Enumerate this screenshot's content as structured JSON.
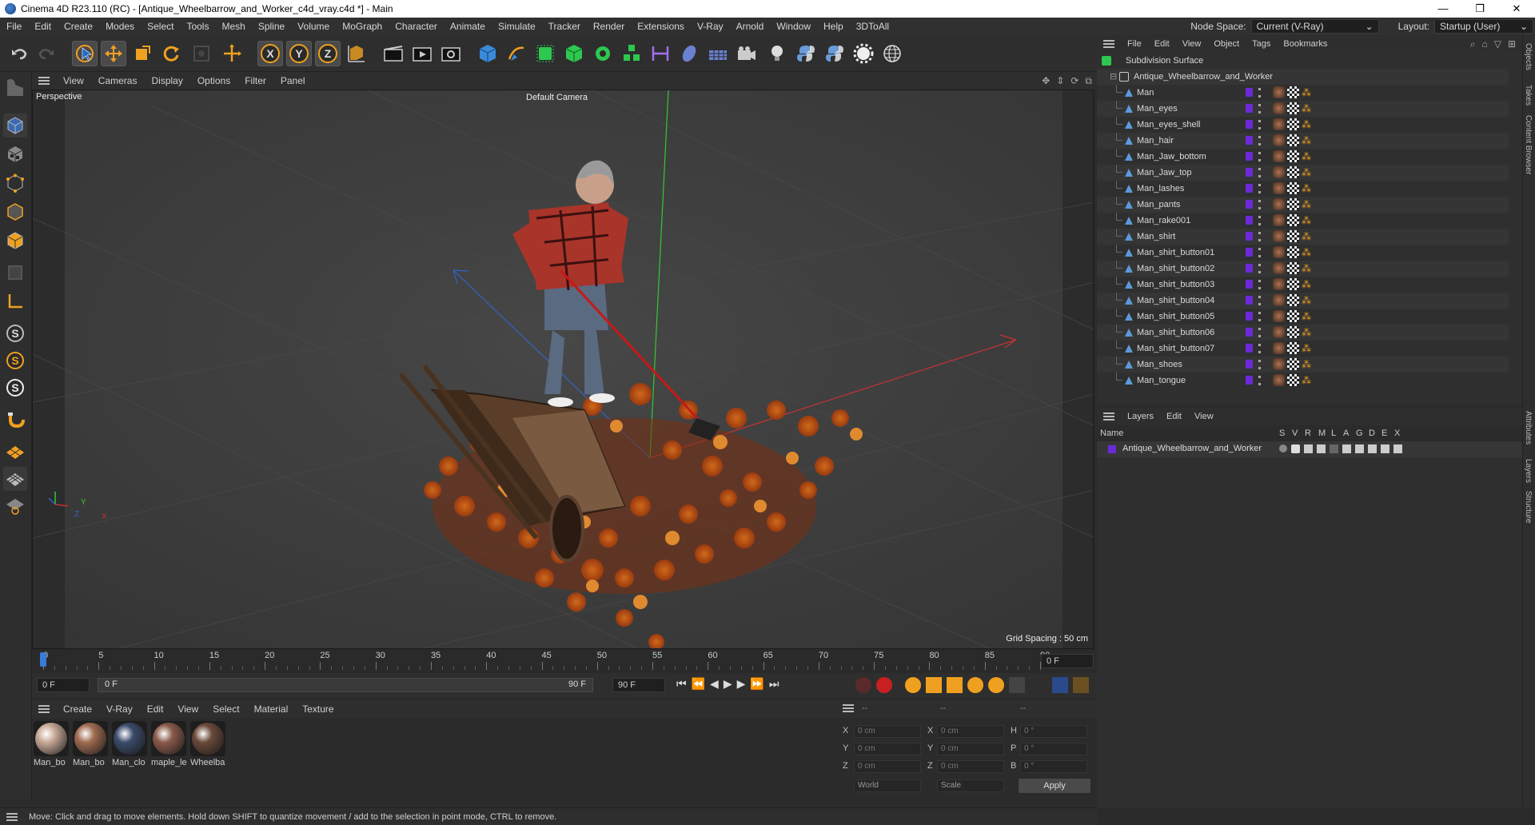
{
  "window": {
    "title": "Cinema 4D R23.110 (RC) - [Antique_Wheelbarrow_and_Worker_c4d_vray.c4d *] - Main",
    "buttons": [
      "—",
      "❐",
      "✕"
    ]
  },
  "menubar": {
    "items": [
      "File",
      "Edit",
      "Create",
      "Modes",
      "Select",
      "Tools",
      "Mesh",
      "Spline",
      "Volume",
      "MoGraph",
      "Character",
      "Animate",
      "Simulate",
      "Tracker",
      "Render",
      "Extensions",
      "V-Ray",
      "Arnold",
      "Window",
      "Help",
      "3DToAll"
    ],
    "node_space_label": "Node Space:",
    "node_space_value": "Current (V-Ray)",
    "layout_label": "Layout:",
    "layout_value": "Startup (User)"
  },
  "viewport": {
    "menu": [
      "View",
      "Cameras",
      "Display",
      "Options",
      "Filter",
      "Panel"
    ],
    "name": "Perspective",
    "camera": "Default Camera",
    "grid_spacing": "Grid Spacing : 50 cm",
    "axis_y": "Y",
    "axis_z": "Z",
    "axis_x": "X"
  },
  "timeline": {
    "ticks": [
      "0",
      "5",
      "10",
      "15",
      "20",
      "25",
      "30",
      "35",
      "40",
      "45",
      "50",
      "55",
      "60",
      "65",
      "70",
      "75",
      "80",
      "85",
      "90"
    ],
    "current_frame": "0 F"
  },
  "transport": {
    "start": "0 F",
    "range_start": "0 F",
    "range_end": "90 F",
    "end": "90 F"
  },
  "materials": {
    "menu": [
      "Create",
      "V-Ray",
      "Edit",
      "View",
      "Select",
      "Material",
      "Texture"
    ],
    "items": [
      {
        "label": "Man_bo",
        "color": "#c8a898"
      },
      {
        "label": "Man_bo",
        "color": "#a06a50"
      },
      {
        "label": "Man_clo",
        "color": "#3a4a6a"
      },
      {
        "label": "maple_le",
        "color": "#8a5a4a"
      },
      {
        "label": "Wheelba",
        "color": "#6a4a3a"
      }
    ]
  },
  "coords": {
    "header": [
      "--",
      "--",
      "--"
    ],
    "rows": [
      {
        "a": "X",
        "av": "0 cm",
        "b": "X",
        "bv": "0 cm",
        "c": "H",
        "cv": "0 °"
      },
      {
        "a": "Y",
        "av": "0 cm",
        "b": "Y",
        "bv": "0 cm",
        "c": "P",
        "cv": "0 °"
      },
      {
        "a": "Z",
        "av": "0 cm",
        "b": "Z",
        "bv": "0 cm",
        "c": "B",
        "cv": "0 °"
      }
    ],
    "world": "World",
    "scale": "Scale",
    "apply": "Apply"
  },
  "status": "Move: Click and drag to move elements. Hold down SHIFT to quantize movement / add to the selection in point mode, CTRL to remove.",
  "objects": {
    "menu": [
      "File",
      "Edit",
      "View",
      "Object",
      "Tags",
      "Bookmarks"
    ],
    "root": "Subdivision Surface",
    "group": "Antique_Wheelbarrow_and_Worker",
    "children": [
      "Man",
      "Man_eyes",
      "Man_eyes_shell",
      "Man_hair",
      "Man_Jaw_bottom",
      "Man_Jaw_top",
      "Man_lashes",
      "Man_pants",
      "Man_rake001",
      "Man_shirt",
      "Man_shirt_button01",
      "Man_shirt_button02",
      "Man_shirt_button03",
      "Man_shirt_button04",
      "Man_shirt_button05",
      "Man_shirt_button06",
      "Man_shirt_button07",
      "Man_shoes",
      "Man_tongue"
    ]
  },
  "side_tabs": [
    "Objects",
    "Takes",
    "Content Browser",
    "Attributes",
    "Layers",
    "Structure"
  ],
  "layers": {
    "menu": [
      "Layers",
      "Edit",
      "View"
    ],
    "col_name": "Name",
    "cols": [
      "S",
      "V",
      "R",
      "M",
      "L",
      "A",
      "G",
      "D",
      "E",
      "X"
    ],
    "row": "Antique_Wheelbarrow_and_Worker"
  },
  "colors": {
    "accent_orange": "#f0a020",
    "layer_purple": "#6a2ad8",
    "axis_x": "#c83232",
    "axis_y": "#32c832",
    "axis_z": "#3264c8"
  }
}
